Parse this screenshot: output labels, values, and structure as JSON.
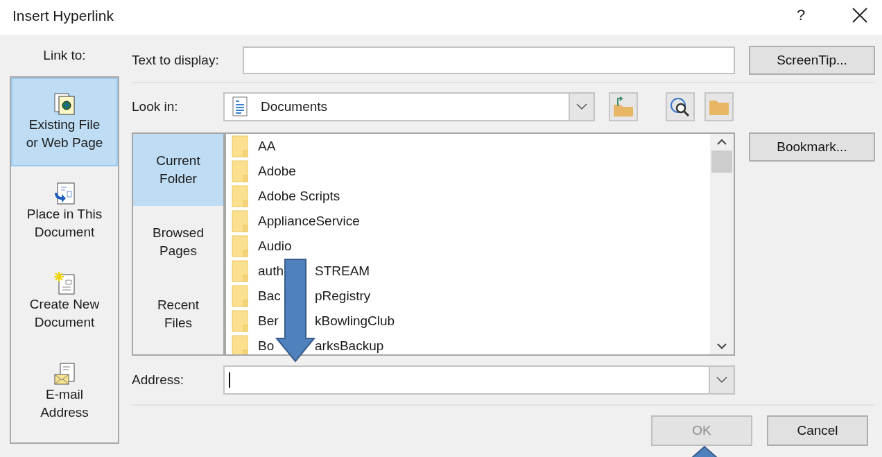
{
  "window": {
    "title": "Insert Hyperlink",
    "help": "?"
  },
  "link_to": {
    "label": "Link to:",
    "items": [
      {
        "kind": "existing_file",
        "lines": [
          "Existing File",
          "or Web Page"
        ],
        "selected": true
      },
      {
        "kind": "place",
        "lines": [
          "Place in This",
          "Document"
        ],
        "selected": false
      },
      {
        "kind": "new_document",
        "lines": [
          "Create New",
          "Document"
        ],
        "selected": false
      },
      {
        "kind": "email",
        "lines": [
          "E-mail",
          "Address"
        ],
        "selected": false
      }
    ]
  },
  "text_to_display": {
    "label": "Text to display:"
  },
  "screentip_button": "ScreenTip...",
  "look_in": {
    "label": "Look in:",
    "value": "Documents"
  },
  "browse_tabs": [
    {
      "lines": [
        "Current",
        "Folder"
      ],
      "selected": true
    },
    {
      "lines": [
        "Browsed",
        "Pages"
      ],
      "selected": false
    },
    {
      "lines": [
        "Recent",
        "Files"
      ],
      "selected": false
    }
  ],
  "files": [
    {
      "kind": "plain",
      "name": "AA"
    },
    {
      "kind": "plain",
      "name": "Adobe"
    },
    {
      "kind": "plain",
      "name": "Adobe Scripts"
    },
    {
      "kind": "plain",
      "name": "ApplianceService"
    },
    {
      "kind": "plain",
      "name": "Audio"
    },
    {
      "kind": "covered",
      "name": "auth",
      "name_end": "STREAM"
    },
    {
      "kind": "covered",
      "name": "Bac",
      "name_end": "pRegistry"
    },
    {
      "kind": "covered",
      "name": "Ber",
      "name_end": "kBowlingClub"
    },
    {
      "kind": "covered",
      "name": "Bo",
      "name_end": "arksBackup"
    }
  ],
  "bookmark_button": "Bookmark...",
  "address": {
    "label": "Address:",
    "focused": true
  },
  "buttons": [
    {
      "label": "OK",
      "disabled": true
    },
    {
      "label": "Cancel",
      "disabled": false
    }
  ]
}
